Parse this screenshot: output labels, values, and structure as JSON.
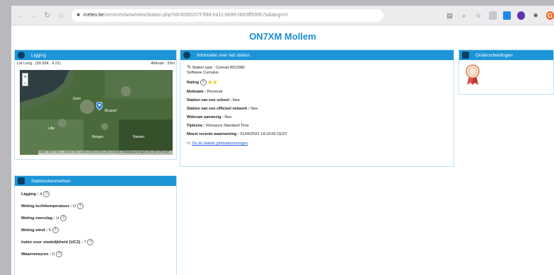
{
  "browser": {
    "url_host": "meteo.be",
    "url_path": "/services/wow/viewStation.php?id=6090207f-ffdd-ea11-b699-0003ff59957a&lang=nl",
    "nav": [
      "back-icon",
      "forward-icon",
      "reload-icon",
      "home-icon"
    ],
    "extensions": [
      "translate-icon",
      "zoom-icon",
      "star-icon",
      "extension-icon",
      "windows-icon",
      "profile-icon",
      "puzzle-icon",
      "user-avatar-icon"
    ],
    "avatar_letter": "G"
  },
  "page": {
    "title": "ON7XM Mollem"
  },
  "location": {
    "header": "Ligging",
    "latlong": "Lat Long : (50.934 , 4.21)",
    "altitude": "Altitude : 33m",
    "zoom_in": "+",
    "zoom_out": "−",
    "attribution": "Leaflet | Tiles © Esri — Source: Esri, i-cubed, USDA, USGS, AEX, GeoEye, Getmapping, Aerogrid, IGN, IGP, UPR-EGP",
    "places": [
      "Gent",
      "Brussel",
      "Lille",
      "Bergen",
      "Namen"
    ]
  },
  "station": {
    "header": "Informatie over het station",
    "type_label": "Station type :",
    "type_value": "Conrad WS1080",
    "software": "Software Cumulus",
    "rating_label": "Rating",
    "stars": 2,
    "motivatie_label": "Motivatie :",
    "motivatie_value": "Personal",
    "school_label": "Station van een school :",
    "school_value": "Nee",
    "official_label": "Station van een officieel netwerk :",
    "official_value": "Nee",
    "webcam_label": "Webcam aanwezig :",
    "webcam_value": "Nee",
    "tz_label": "Tijdzone :",
    "tz_value": "Romance Standard Time",
    "recent_label": "Meest recente waarneming :",
    "recent_value": "01/04/2021 14:10:00 CEST",
    "link_text": "Zie de laatste plotwaarnemingen"
  },
  "quality": {
    "header": "Stationskenmerken",
    "items": [
      {
        "label": "Ligging :",
        "value": "4"
      },
      {
        "label": "Meting luchttemperatuur :",
        "value": "U"
      },
      {
        "label": "Meting neerslag :",
        "value": "U"
      },
      {
        "label": "Meting wind :",
        "value": "5"
      },
      {
        "label": "Index voor stedelijkheid (UCZ) :",
        "value": "7"
      },
      {
        "label": "Waarnemuren :",
        "value": "C"
      }
    ]
  },
  "awards": {
    "header": "Onderscheidingen"
  },
  "colors": {
    "accent": "#1c95d8",
    "title": "#1b8fd8",
    "link": "#1a5bd6"
  }
}
